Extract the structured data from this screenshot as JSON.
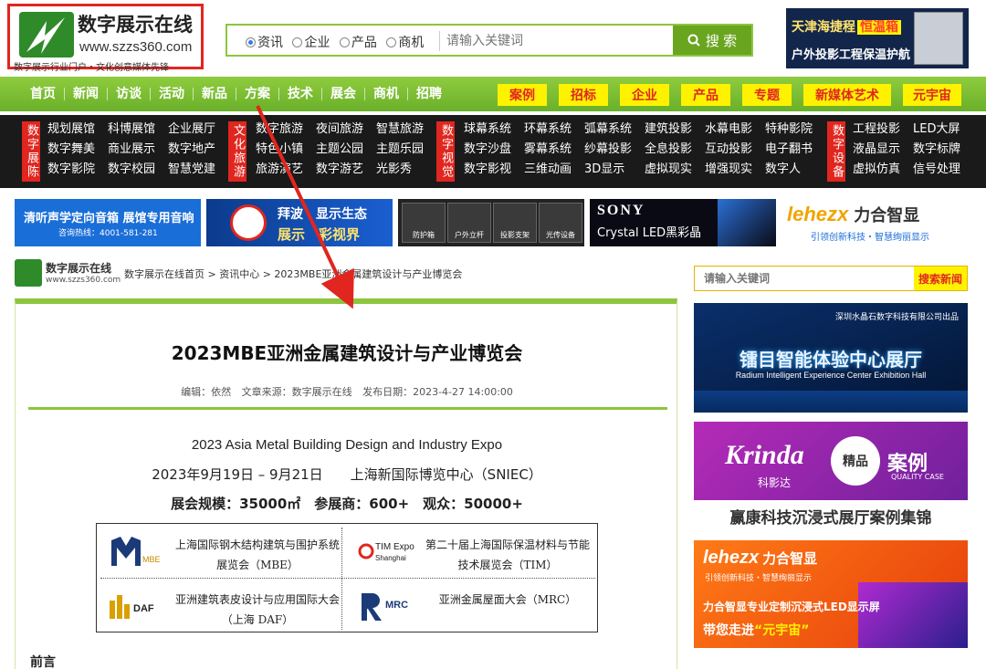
{
  "header": {
    "logo_title": "数字展示在线",
    "logo_url": "www.szzs360.com",
    "logo_slogan": "数字展示行业门户・文化创意媒体先锋",
    "search": {
      "options": [
        "资讯",
        "企业",
        "产品",
        "商机"
      ],
      "selected": "资讯",
      "placeholder": "请输入关键词",
      "button": "搜 索"
    },
    "top_ad": {
      "line1": "天津海捷程",
      "line1_hl": "恒温箱",
      "line2": "户外投影工程保温护航"
    }
  },
  "nav": {
    "items": [
      "首页",
      "新闻",
      "访谈",
      "活动",
      "新品",
      "方案",
      "技术",
      "展会",
      "商机",
      "招聘"
    ],
    "highlights": [
      "案例",
      "招标",
      "企业",
      "产品",
      "专题",
      "新媒体艺术",
      "元宇宙"
    ]
  },
  "categories": [
    {
      "tag": "数字展陈",
      "links": [
        "规划展馆",
        "科博展馆",
        "企业展厅",
        "数字舞美",
        "商业展示",
        "数字地产",
        "数字影院",
        "数字校园",
        "智慧党建"
      ]
    },
    {
      "tag": "文化旅游",
      "links": [
        "数字旅游",
        "夜间旅游",
        "智慧旅游",
        "特色小镇",
        "主题公园",
        "主题乐园",
        "旅游演艺",
        "数字游艺",
        "光影秀"
      ]
    },
    {
      "tag": "数字视觉",
      "links": [
        "球幕系统",
        "环幕系统",
        "弧幕系统",
        "建筑投影",
        "水幕电影",
        "特种影院",
        "数字沙盘",
        "雾幕系统",
        "纱幕投影",
        "全息投影",
        "互动投影",
        "电子翻书",
        "数字影视",
        "三维动画",
        "3D显示",
        "虚拟现实",
        "增强现实",
        "数字人"
      ]
    },
    {
      "tag": "数字设备",
      "links": [
        "工程投影",
        "LED大屏",
        "液晶显示",
        "数字标牌",
        "虚拟仿真",
        "信号处理"
      ]
    }
  ],
  "banners": {
    "b1": {
      "line1": "清听声学定向音箱 展馆专用音响",
      "line2": "咨询热线：4001-581-281"
    },
    "b2": {
      "line1": "拜波",
      "line1b": "显示生态",
      "line2": "展示",
      "line2b": "彩视界"
    },
    "b3": {
      "labels": [
        "防护箱",
        "户外立杆",
        "投影支架",
        "光传设备"
      ]
    },
    "b4": {
      "line1": "SONY",
      "line2": "Crystal LED黑彩晶"
    },
    "b5": {
      "brand": "lehezx",
      "brand_cn": "力合智显",
      "slogan": "引领创新科技・智慧绚丽显示"
    }
  },
  "breadcrumb": {
    "logo_title": "数字展示在线",
    "logo_url": "www.szzs360.com",
    "path": "数字展示在线首页 > 资讯中心 > 2023MBE亚洲金属建筑设计与产业博览会"
  },
  "article": {
    "title": "2023MBE亚洲金属建筑设计与产业博览会",
    "meta": {
      "editor": "编辑：依然",
      "source": "文章来源：数字展示在线",
      "date": "发布日期：2023-4-27 14:00:00"
    },
    "line_en": "2023 Asia Metal Building Design and Industry Expo",
    "line_date": "2023年9月19日 – 9月21日　　上海新国际博览中心（SNIEC）",
    "line_scale": "展会规模：35000㎡　参展商：600+　观众：50000+",
    "logos": [
      {
        "mark": "MBE",
        "name": "上海国际钢木结构建筑与围护系统展览会（MBE）"
      },
      {
        "mark": "TIM Expo Shanghai",
        "name": "第二十届上海国际保温材料与节能技术展览会（TIM）"
      },
      {
        "mark": "DAF",
        "name": "亚洲建筑表皮设计与应用国际大会（上海 DAF）"
      },
      {
        "mark": "MRC",
        "name": "亚洲金属屋面大会（MRC）"
      }
    ],
    "preface": "前言"
  },
  "sidebar": {
    "search_placeholder": "请输入关键词",
    "search_button": "搜索新闻",
    "ad1": {
      "top": "深圳水晶石数字科技有限公司出品",
      "title": "镭目智能体验中心展厅",
      "en": "Radium Intelligent Experience Center Exhibition Hall"
    },
    "ad2": {
      "brand": "Krinda",
      "brand_cn": "科影达",
      "seal": "精品",
      "case": "案例",
      "case_en": "QUALITY CASE",
      "strip": "赢康科技沉浸式展厅案例集锦"
    },
    "ad3": {
      "brand": "lehezx",
      "brand_cn": "力合智显",
      "slogan": "引领创新科技・智慧绚丽显示",
      "line1": "力合智显专业定制沉浸式LED显示屏",
      "line2": "带您走进",
      "line2b": "“元宇宙”"
    }
  },
  "colors": {
    "accent_green": "#8cc63f",
    "red": "#e0261f",
    "yellow": "#fff200"
  }
}
